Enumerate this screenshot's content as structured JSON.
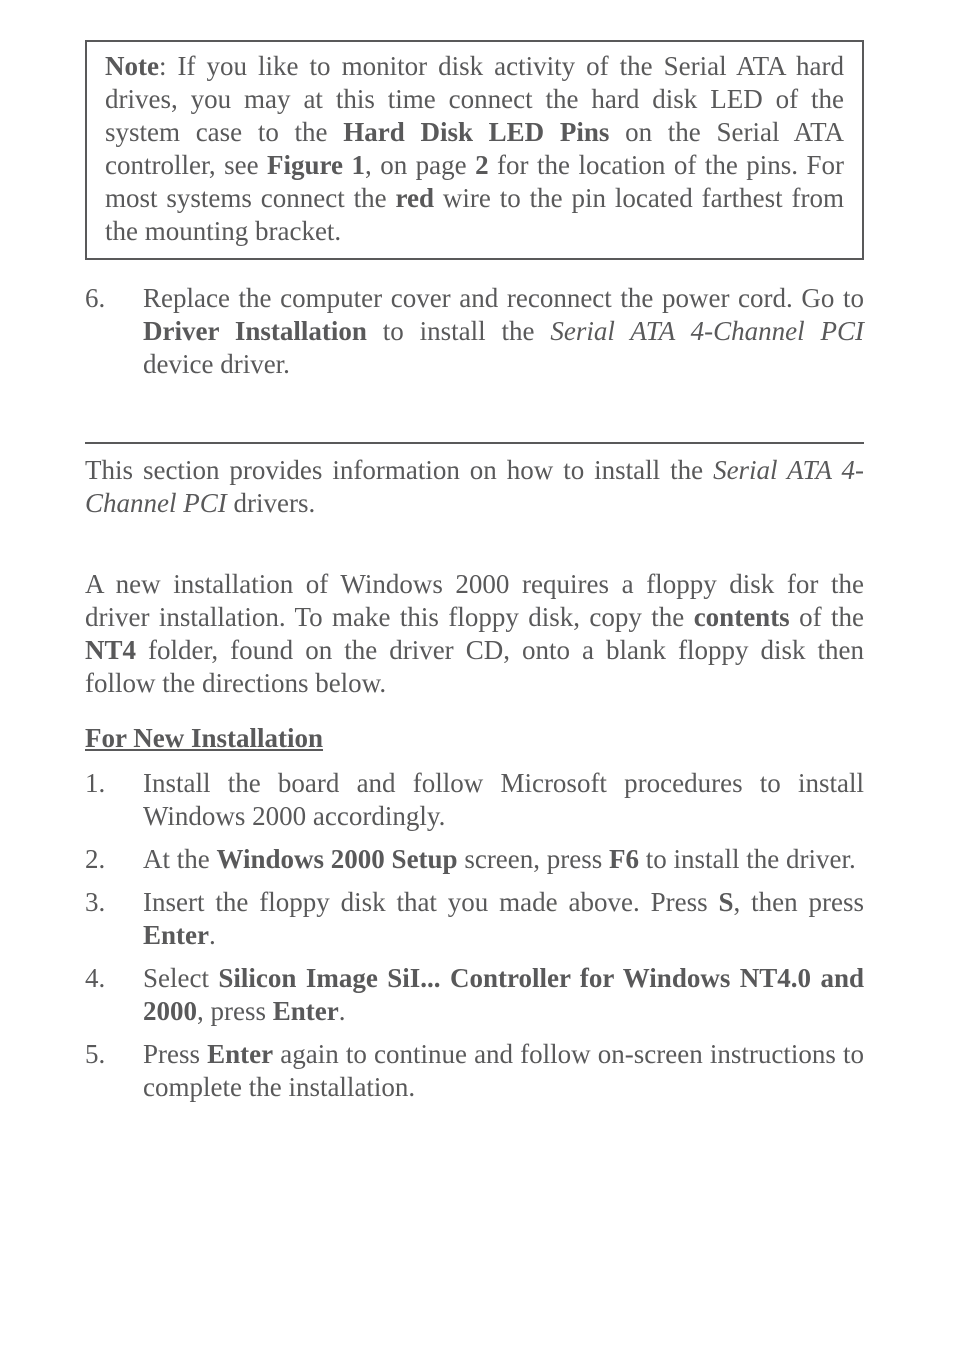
{
  "note": {
    "label": "Note",
    "text1": ":  If you like to monitor disk activity of the Serial ATA hard drives, you may at this time connect the hard disk LED of the system case to the ",
    "b1": "Hard Disk LED Pins",
    "text2": " on the Serial ATA controller, see ",
    "b2": "Figure 1",
    "text3": ", on page ",
    "b3": "2",
    "text4": " for the location of the pins.   For most systems connect the ",
    "b4": "red",
    "text5": " wire to the pin located farthest from the mounting bracket."
  },
  "item6": {
    "num": "6.",
    "a": "Replace the computer cover and reconnect the power cord.  Go to ",
    "b1": "Driver Installation",
    "b": " to install the ",
    "i1": "Serial ATA 4-Channel PCI",
    "c": " device driver."
  },
  "p1": {
    "a": "This section provides information on how to install the ",
    "i1": "Serial ATA 4-Channel PCI",
    "b": " drivers."
  },
  "p2": {
    "a": "A new installation of Windows 2000 requires a floppy disk for the driver installation.  To make this floppy disk, copy the ",
    "b1": "contents",
    "b": " of the ",
    "b2": "NT4",
    "c": " folder, found on the driver CD, onto a blank floppy disk then follow the directions below."
  },
  "head2": "For New Installation",
  "steps": {
    "s1": {
      "num": "1.",
      "text": "Install the board and follow Microsoft procedures to install Windows 2000 accordingly."
    },
    "s2": {
      "num": "2.",
      "a": "At the ",
      "b1": "Windows 2000 Setup",
      "b": " screen, press ",
      "b2": "F6",
      "c": " to install the driver."
    },
    "s3": {
      "num": "3.",
      "a": "Insert the floppy disk that you made above.  Press ",
      "b1": "S",
      "b": ", then press ",
      "b2": "Enter",
      "c": "."
    },
    "s4": {
      "num": "4.",
      "a": "Select ",
      "b1": "Silicon Image SiI... Controller for Windows NT4.0 and 2000",
      "b": ", press ",
      "b2": "Enter",
      "c": "."
    },
    "s5": {
      "num": "5.",
      "a": "Press ",
      "b1": "Enter",
      "b": " again to continue and follow on-screen instructions to complete the installation."
    }
  }
}
